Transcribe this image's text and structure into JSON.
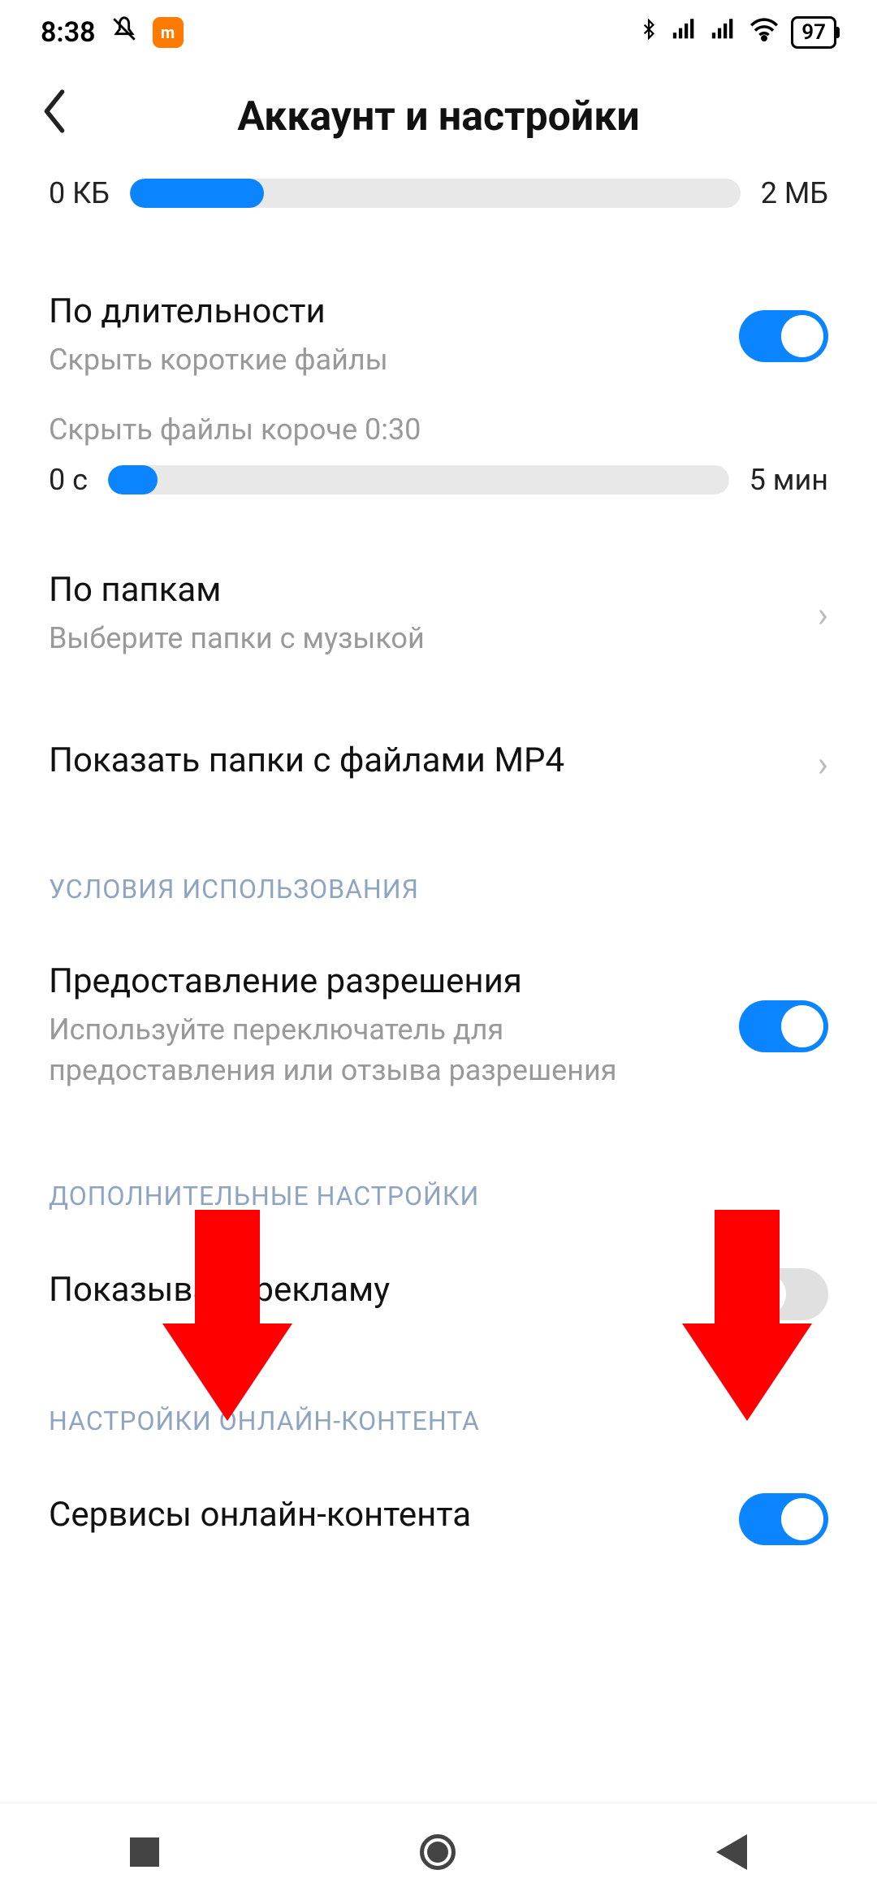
{
  "status": {
    "time": "8:38",
    "battery": "97"
  },
  "header": {
    "title": "Аккаунт и настройки"
  },
  "size_slider": {
    "min_label": "0 КБ",
    "max_label": "2 МБ",
    "fill_percent": 22
  },
  "duration": {
    "title": "По длительности",
    "subtitle": "Скрыть короткие файлы",
    "toggle_on": true,
    "hint": "Скрыть файлы короче 0:30",
    "slider_min": "0 с",
    "slider_max": "5 мин",
    "slider_fill_percent": 8
  },
  "folders": {
    "title": "По папкам",
    "subtitle": "Выберите папки с музыкой"
  },
  "mp4": {
    "title": "Показать папки с файлами MP4"
  },
  "sections": {
    "terms": "УСЛОВИЯ ИСПОЛЬЗОВАНИЯ",
    "additional": "ДОПОЛНИТЕЛЬНЫЕ НАСТРОЙКИ",
    "online": "НАСТРОЙКИ ОНЛАЙН-КОНТЕНТА"
  },
  "permission": {
    "title": "Предоставление разрешения",
    "subtitle": "Используйте переключатель для предоставления или отзыва разрешения",
    "toggle_on": true
  },
  "ads": {
    "title": "Показывать рекламу",
    "toggle_on": false
  },
  "online_services": {
    "title": "Сервисы онлайн-контента",
    "toggle_on": true
  }
}
